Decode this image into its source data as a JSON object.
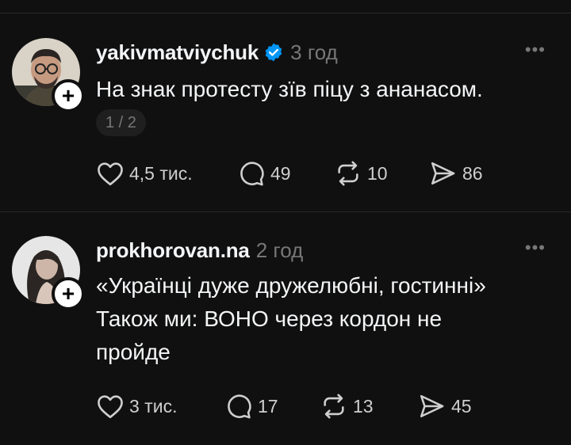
{
  "posts": [
    {
      "username": "yakivmatviychuk",
      "verified": true,
      "time": "3 год",
      "text": "На знак протесту зїв піцу з ананасом.",
      "pager": "1 / 2",
      "likes": "4,5 тис.",
      "comments": "49",
      "reposts": "10",
      "shares": "86"
    },
    {
      "username": "prokhorovan.na",
      "verified": false,
      "time": "2 год",
      "text": "«Українці дуже дружелюбні, гостинні»\nТакож ми: ВОНО через кордон не\nпройде",
      "likes": "3 тис.",
      "comments": "17",
      "reposts": "13",
      "shares": "45"
    }
  ],
  "icons": {
    "more": "more-icon",
    "follow": "plus-icon",
    "verified": "verified-badge-icon",
    "like": "heart-icon",
    "comment": "comment-icon",
    "repost": "repost-icon",
    "share": "send-icon"
  },
  "colors": {
    "background": "#101010",
    "text": "#f3f5f7",
    "muted": "#777777",
    "verified": "#0095f6"
  }
}
